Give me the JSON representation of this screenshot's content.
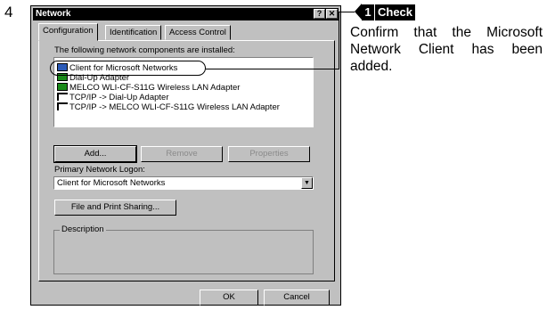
{
  "step_number": "4",
  "window": {
    "title": "Network",
    "help_button": "?",
    "close_button": "✕"
  },
  "tabs": [
    "Configuration",
    "Identification",
    "Access Control"
  ],
  "components_label": "The following network components are installed:",
  "components": [
    {
      "label": "Client for Microsoft Networks",
      "icon": "network-client-icon"
    },
    {
      "label": "Dial-Up Adapter",
      "icon": "adapter-icon"
    },
    {
      "label": "MELCO WLI-CF-S11G Wireless LAN Adapter",
      "icon": "adapter-icon"
    },
    {
      "label": "TCP/IP -> Dial-Up Adapter",
      "icon": "protocol-icon"
    },
    {
      "label": "TCP/IP -> MELCO WLI-CF-S11G Wireless LAN Adapter",
      "icon": "protocol-icon"
    }
  ],
  "buttons": {
    "add": "Add...",
    "remove": "Remove",
    "properties": "Properties",
    "file_print": "File and Print Sharing...",
    "ok": "OK",
    "cancel": "Cancel"
  },
  "primary_logon": {
    "label": "Primary Network Logon:",
    "value": "Client for Microsoft Networks"
  },
  "description_label": "Description",
  "check": {
    "number": "1",
    "word": "Check",
    "text": "Confirm that the Microsoft Network Client has been added."
  }
}
